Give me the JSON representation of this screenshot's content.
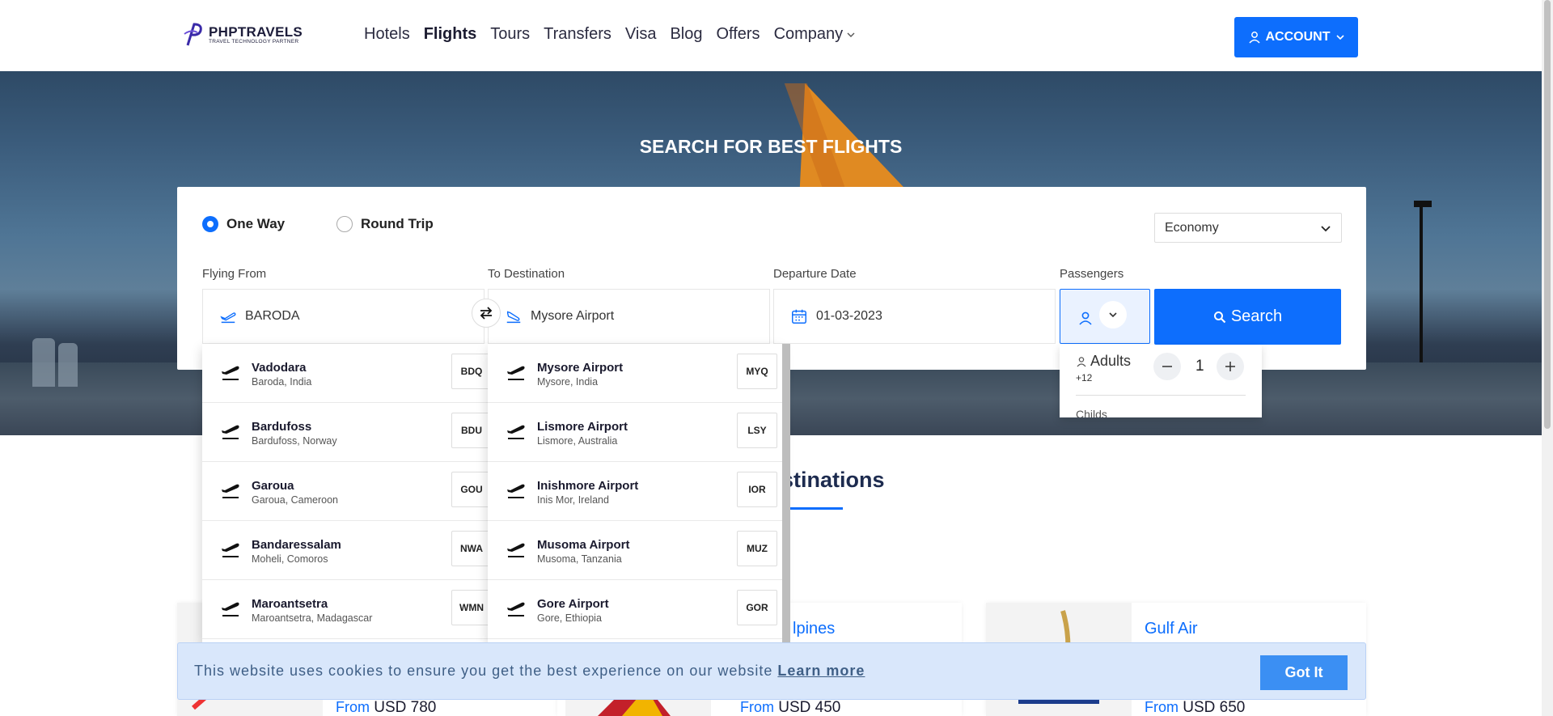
{
  "header": {
    "logo_name": "PHPTRAVELS",
    "logo_tagline": "TRAVEL TECHNOLOGY PARTNER",
    "nav": [
      "Hotels",
      "Flights",
      "Tours",
      "Transfers",
      "Visa",
      "Blog",
      "Offers",
      "Company"
    ],
    "active_nav": "Flights",
    "account_label": "ACCOUNT"
  },
  "hero": {
    "title": "SEARCH FOR BEST FLIGHTS"
  },
  "search": {
    "trip_types": [
      "One Way",
      "Round Trip"
    ],
    "selected_trip": "One Way",
    "cabin_class": "Economy",
    "labels": {
      "from": "Flying From",
      "to": "To Destination",
      "date": "Departure Date",
      "passengers": "Passengers"
    },
    "from_value": "BARODA",
    "to_value": "Mysore Airport",
    "date_value": "01-03-2023",
    "search_label": "Search",
    "passengers": {
      "adults_label": "Adults",
      "adults_hint": "+12",
      "adults_count": "1",
      "next_label": "Childs"
    }
  },
  "from_suggestions": [
    {
      "name": "Vadodara",
      "location": "Baroda, India",
      "code": "BDQ"
    },
    {
      "name": "Bardufoss",
      "location": "Bardufoss, Norway",
      "code": "BDU"
    },
    {
      "name": "Garoua",
      "location": "Garoua, Cameroon",
      "code": "GOU"
    },
    {
      "name": "Bandaressalam",
      "location": "Moheli, Comoros",
      "code": "NWA"
    },
    {
      "name": "Maroantsetra",
      "location": "Maroantsetra, Madagascar",
      "code": "WMN"
    }
  ],
  "to_suggestions": [
    {
      "name": "Mysore Airport",
      "location": "Mysore, India",
      "code": "MYQ"
    },
    {
      "name": "Lismore Airport",
      "location": "Lismore, Australia",
      "code": "LSY"
    },
    {
      "name": "Inishmore Airport",
      "location": "Inis Mor, Ireland",
      "code": "IOR"
    },
    {
      "name": "Musoma Airport",
      "location": "Musoma, Tanzania",
      "code": "MUZ"
    },
    {
      "name": "Gore Airport",
      "location": "Gore, Ethiopia",
      "code": "GOR"
    }
  ],
  "destinations": {
    "title_fragment": "stinations",
    "cards": [
      {
        "name": "",
        "from_label": "From",
        "price": "USD 780"
      },
      {
        "name": "lpines",
        "from_label": "From",
        "price": "USD 450"
      },
      {
        "name": "Gulf Air",
        "from_label": "From",
        "price": "USD 650"
      }
    ]
  },
  "cookie": {
    "message": "This website uses cookies to ensure you get the best experience on our website",
    "link": "Learn more",
    "button": "Got It"
  },
  "colors": {
    "primary": "#0d6efd",
    "cookie_bg": "#d9e7fb",
    "cookie_button": "#3b8ff3"
  }
}
